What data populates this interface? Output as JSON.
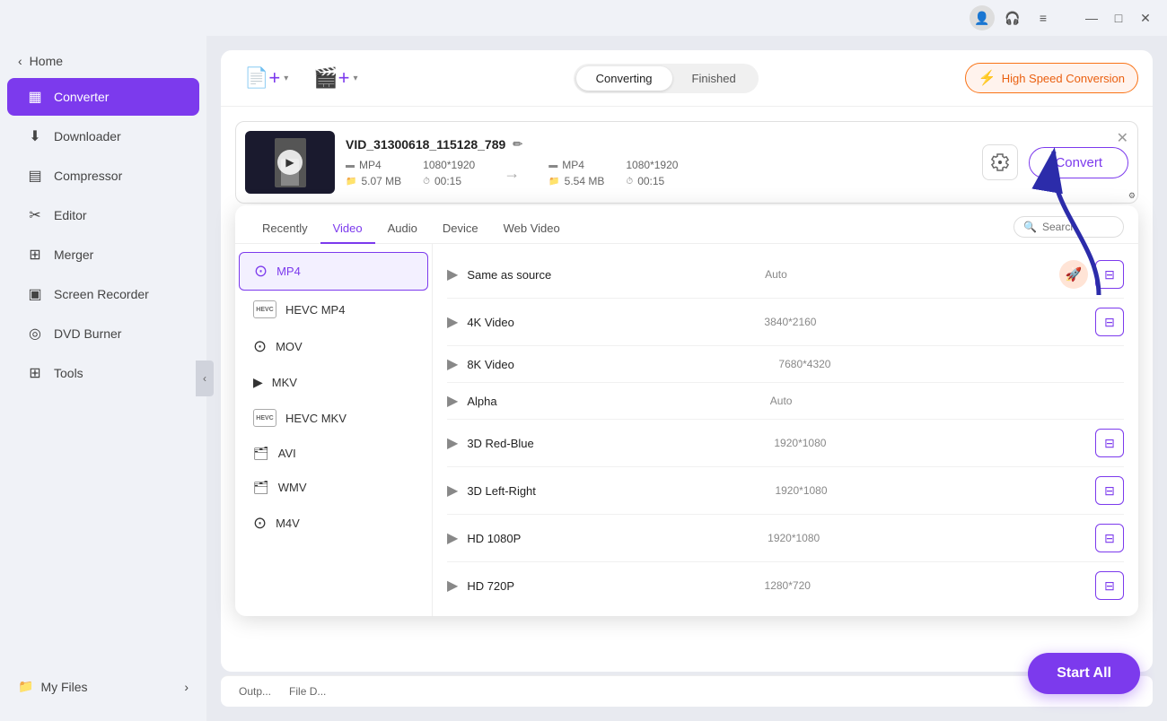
{
  "titlebar": {
    "profile_icon": "👤",
    "headset_icon": "🎧",
    "menu_icon": "≡",
    "minimize": "—",
    "maximize": "□",
    "close": "✕"
  },
  "sidebar": {
    "home_label": "Home",
    "items": [
      {
        "id": "converter",
        "label": "Converter",
        "icon": "▦",
        "active": true
      },
      {
        "id": "downloader",
        "label": "Downloader",
        "icon": "⬇"
      },
      {
        "id": "compressor",
        "label": "Compressor",
        "icon": "▤"
      },
      {
        "id": "editor",
        "label": "Editor",
        "icon": "✂"
      },
      {
        "id": "merger",
        "label": "Merger",
        "icon": "⊞"
      },
      {
        "id": "screen-recorder",
        "label": "Screen Recorder",
        "icon": "▣"
      },
      {
        "id": "dvd-burner",
        "label": "DVD Burner",
        "icon": "◎"
      },
      {
        "id": "tools",
        "label": "Tools",
        "icon": "⊞"
      }
    ],
    "my_files_label": "My Files"
  },
  "topbar": {
    "add_file_icon": "📄",
    "add_media_icon": "🎬",
    "tab_converting": "Converting",
    "tab_finished": "Finished",
    "high_speed_label": "High Speed Conversion",
    "lightning_icon": "⚡"
  },
  "file_item": {
    "filename": "VID_31300618_115128_789",
    "edit_icon": "✏",
    "source_format": "MP4",
    "source_res": "1080*1920",
    "source_size": "5.07 MB",
    "source_duration": "00:15",
    "dest_format": "MP4",
    "dest_res": "1080*1920",
    "dest_size": "5.54 MB",
    "dest_duration": "00:15",
    "convert_label": "Convert",
    "close_icon": "✕"
  },
  "format_dropdown": {
    "tabs": [
      "Recently",
      "Video",
      "Audio",
      "Device",
      "Web Video"
    ],
    "active_tab": "Video",
    "search_placeholder": "Search",
    "formats": [
      {
        "id": "mp4",
        "label": "MP4",
        "selected": true,
        "icon_type": "normal"
      },
      {
        "id": "hevc-mp4",
        "label": "HEVC MP4",
        "icon_type": "hevc"
      },
      {
        "id": "mov",
        "label": "MOV",
        "icon_type": "circle"
      },
      {
        "id": "mkv",
        "label": "MKV",
        "icon_type": "play"
      },
      {
        "id": "hevc-mkv",
        "label": "HEVC MKV",
        "icon_type": "hevc"
      },
      {
        "id": "avi",
        "label": "AVI",
        "icon_type": "folder"
      },
      {
        "id": "wmv",
        "label": "WMV",
        "icon_type": "folder"
      },
      {
        "id": "m4v",
        "label": "M4V",
        "icon_type": "circle"
      }
    ],
    "presets": [
      {
        "id": "same-source",
        "label": "Same as source",
        "res": "Auto",
        "has_rocket": true,
        "has_edit": true
      },
      {
        "id": "4k-video",
        "label": "4K Video",
        "res": "3840*2160",
        "has_rocket": false,
        "has_edit": true
      },
      {
        "id": "8k-video",
        "label": "8K Video",
        "res": "7680*4320",
        "has_rocket": false,
        "has_edit": false
      },
      {
        "id": "alpha",
        "label": "Alpha",
        "res": "Auto",
        "has_rocket": false,
        "has_edit": false
      },
      {
        "id": "3d-red-blue",
        "label": "3D Red-Blue",
        "res": "1920*1080",
        "has_rocket": false,
        "has_edit": true
      },
      {
        "id": "3d-left-right",
        "label": "3D Left-Right",
        "res": "1920*1080",
        "has_rocket": false,
        "has_edit": true
      },
      {
        "id": "hd-1080p",
        "label": "HD 1080P",
        "res": "1920*1080",
        "has_rocket": false,
        "has_edit": true
      },
      {
        "id": "hd-720p",
        "label": "HD 720P",
        "res": "1280*720",
        "has_rocket": false,
        "has_edit": true
      }
    ]
  },
  "bottom": {
    "output_label": "Outp...",
    "file_label": "File D..."
  },
  "start_all_label": "Start All"
}
